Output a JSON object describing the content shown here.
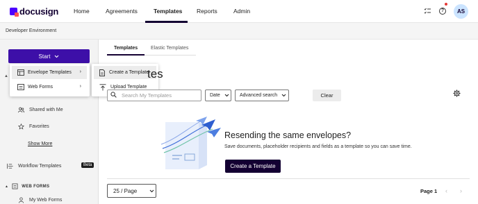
{
  "brand": {
    "name": "docusign"
  },
  "nav": {
    "items": [
      "Home",
      "Agreements",
      "Templates",
      "Reports",
      "Admin"
    ],
    "active": "Templates"
  },
  "user": {
    "initials": "AS"
  },
  "env": {
    "label": "Developer Environment"
  },
  "sidebar": {
    "start_label": "Start",
    "items": [
      {
        "label": "Shared with Me",
        "icon": "users-icon"
      },
      {
        "label": "Favorites",
        "icon": "star-icon"
      }
    ],
    "show_more": "Show More",
    "workflow": {
      "label": "Workflow Templates",
      "badge": "Beta"
    },
    "section": {
      "label": "WEB FORMS"
    },
    "my_web_forms": "My Web Forms"
  },
  "start_menu": {
    "items": [
      {
        "label": "Envelope Templates",
        "icon": "envelope-template-icon"
      },
      {
        "label": "Web Forms",
        "icon": "web-form-icon"
      }
    ]
  },
  "submenu": {
    "items": [
      {
        "label": "Create a Template",
        "icon": "document-icon"
      },
      {
        "label": "Upload Template",
        "icon": "upload-icon"
      }
    ]
  },
  "tabs": [
    "Templates",
    "Elastic Templates"
  ],
  "main": {
    "title_fragment": "tes",
    "search_placeholder": "Search My Templates",
    "date_filter": "Date",
    "advanced_search": "Advanced search",
    "clear": "Clear",
    "empty_title": "Resending the same envelopes?",
    "empty_sub": "Save documents, placeholder recipients and fields as a template so you can save time.",
    "create_button": "Create a Template"
  },
  "pagination": {
    "per_page": "25 / Page",
    "page_label": "Page 1"
  },
  "colors": {
    "primary": "#3d0fa8",
    "dark": "#130032",
    "avatar_bg": "#cbe4ff",
    "notification": "#e53935"
  }
}
